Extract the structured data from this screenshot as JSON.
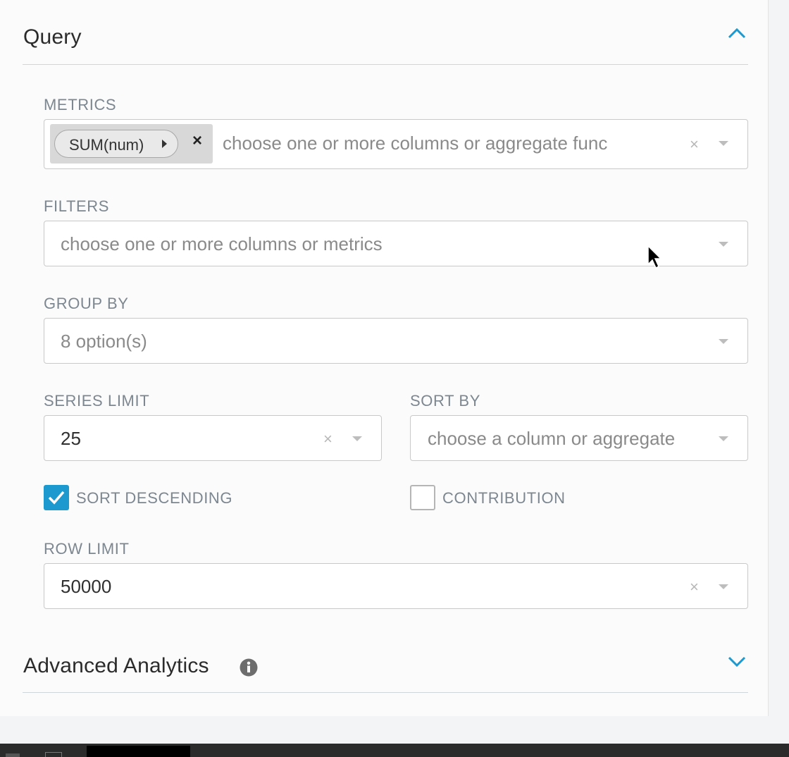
{
  "query": {
    "title": "Query",
    "collapse_icon": "chevron-up-icon",
    "metrics": {
      "label": "METRICS",
      "chip_label": "SUM(num)",
      "chip_remove": "×",
      "placeholder": "choose one or more columns or aggregate func",
      "clear": "×"
    },
    "filters": {
      "label": "FILTERS",
      "placeholder": "choose one or more columns or metrics"
    },
    "group_by": {
      "label": "GROUP BY",
      "value": "8 option(s)"
    },
    "series_limit": {
      "label": "SERIES LIMIT",
      "value": "25",
      "clear": "×"
    },
    "sort_by": {
      "label": "SORT BY",
      "placeholder": "choose a column or aggregate"
    },
    "sort_descending": {
      "label": "SORT DESCENDING",
      "checked": true
    },
    "contribution": {
      "label": "CONTRIBUTION",
      "checked": false
    },
    "row_limit": {
      "label": "ROW LIMIT",
      "value": "50000",
      "clear": "×"
    }
  },
  "advanced_analytics": {
    "title": "Advanced Analytics",
    "info_icon": "info-icon",
    "expand_icon": "chevron-down-icon"
  },
  "colors": {
    "accent": "#1c9ad0",
    "label": "#7d8790",
    "border": "#c9c9c9"
  }
}
